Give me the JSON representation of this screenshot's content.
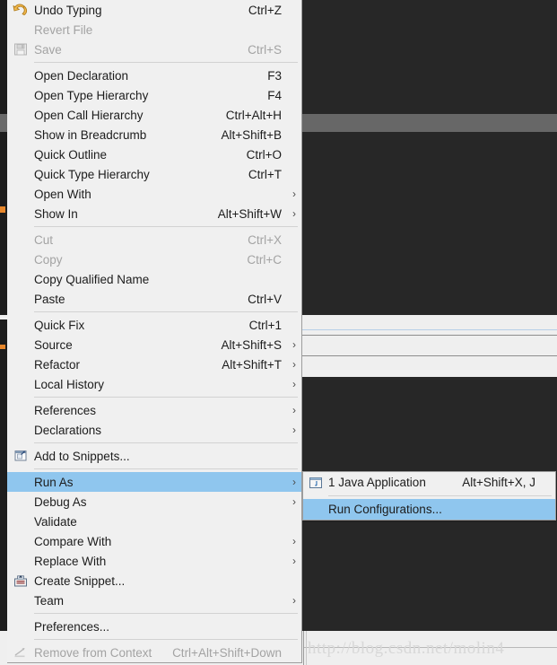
{
  "window": {
    "background_dark": "#272727",
    "background_light": "#efefef",
    "accent_selection": "#8fc6ee"
  },
  "watermark": {
    "text": "http://blog.csdn.net/molin4"
  },
  "context_menu": {
    "items": [
      {
        "label": "Undo Typing",
        "accel": "Ctrl+Z",
        "icon": "undo-arrow-icon",
        "disabled": false,
        "submenu": false
      },
      {
        "label": "Revert File",
        "accel": "",
        "icon": "",
        "disabled": true,
        "submenu": false
      },
      {
        "label": "Save",
        "accel": "Ctrl+S",
        "icon": "save-disk-icon",
        "disabled": true,
        "submenu": false
      },
      {
        "separator": true
      },
      {
        "label": "Open Declaration",
        "accel": "F3",
        "icon": "",
        "disabled": false,
        "submenu": false
      },
      {
        "label": "Open Type Hierarchy",
        "accel": "F4",
        "icon": "",
        "disabled": false,
        "submenu": false
      },
      {
        "label": "Open Call Hierarchy",
        "accel": "Ctrl+Alt+H",
        "icon": "",
        "disabled": false,
        "submenu": false
      },
      {
        "label": "Show in Breadcrumb",
        "accel": "Alt+Shift+B",
        "icon": "",
        "disabled": false,
        "submenu": false
      },
      {
        "label": "Quick Outline",
        "accel": "Ctrl+O",
        "icon": "",
        "disabled": false,
        "submenu": false
      },
      {
        "label": "Quick Type Hierarchy",
        "accel": "Ctrl+T",
        "icon": "",
        "disabled": false,
        "submenu": false
      },
      {
        "label": "Open With",
        "accel": "",
        "icon": "",
        "disabled": false,
        "submenu": true
      },
      {
        "label": "Show In",
        "accel": "Alt+Shift+W",
        "icon": "",
        "disabled": false,
        "submenu": true
      },
      {
        "separator": true
      },
      {
        "label": "Cut",
        "accel": "Ctrl+X",
        "icon": "",
        "disabled": true,
        "submenu": false
      },
      {
        "label": "Copy",
        "accel": "Ctrl+C",
        "icon": "",
        "disabled": true,
        "submenu": false
      },
      {
        "label": "Copy Qualified Name",
        "accel": "",
        "icon": "",
        "disabled": false,
        "submenu": false
      },
      {
        "label": "Paste",
        "accel": "Ctrl+V",
        "icon": "",
        "disabled": false,
        "submenu": false
      },
      {
        "separator": true
      },
      {
        "label": "Quick Fix",
        "accel": "Ctrl+1",
        "icon": "",
        "disabled": false,
        "submenu": false
      },
      {
        "label": "Source",
        "accel": "Alt+Shift+S",
        "icon": "",
        "disabled": false,
        "submenu": true
      },
      {
        "label": "Refactor",
        "accel": "Alt+Shift+T",
        "icon": "",
        "disabled": false,
        "submenu": true
      },
      {
        "label": "Local History",
        "accel": "",
        "icon": "",
        "disabled": false,
        "submenu": true
      },
      {
        "separator": true
      },
      {
        "label": "References",
        "accel": "",
        "icon": "",
        "disabled": false,
        "submenu": true
      },
      {
        "label": "Declarations",
        "accel": "",
        "icon": "",
        "disabled": false,
        "submenu": true
      },
      {
        "separator": true
      },
      {
        "label": "Add to Snippets...",
        "accel": "",
        "icon": "add-snippet-icon",
        "disabled": false,
        "submenu": false
      },
      {
        "separator": true
      },
      {
        "label": "Run As",
        "accel": "",
        "icon": "",
        "disabled": false,
        "submenu": true,
        "selected": true
      },
      {
        "label": "Debug As",
        "accel": "",
        "icon": "",
        "disabled": false,
        "submenu": true
      },
      {
        "label": "Validate",
        "accel": "",
        "icon": "",
        "disabled": false,
        "submenu": false
      },
      {
        "label": "Compare With",
        "accel": "",
        "icon": "",
        "disabled": false,
        "submenu": true
      },
      {
        "label": "Replace With",
        "accel": "",
        "icon": "",
        "disabled": false,
        "submenu": true
      },
      {
        "label": "Create Snippet...",
        "accel": "",
        "icon": "create-snippet-icon",
        "disabled": false,
        "submenu": false
      },
      {
        "label": "Team",
        "accel": "",
        "icon": "",
        "disabled": false,
        "submenu": true
      },
      {
        "separator": true
      },
      {
        "label": "Preferences...",
        "accel": "",
        "icon": "",
        "disabled": false,
        "submenu": false
      },
      {
        "separator": true
      },
      {
        "label": "Remove from Context",
        "accel": "Ctrl+Alt+Shift+Down",
        "icon": "remove-context-icon",
        "disabled": true,
        "submenu": false
      }
    ]
  },
  "run_as_submenu": {
    "items": [
      {
        "label": "1 Java Application",
        "accel": "Alt+Shift+X, J",
        "icon": "java-application-icon",
        "disabled": false,
        "selected": false
      },
      {
        "separator": true
      },
      {
        "label": "Run Configurations...",
        "accel": "",
        "icon": "",
        "disabled": false,
        "selected": true
      }
    ]
  }
}
